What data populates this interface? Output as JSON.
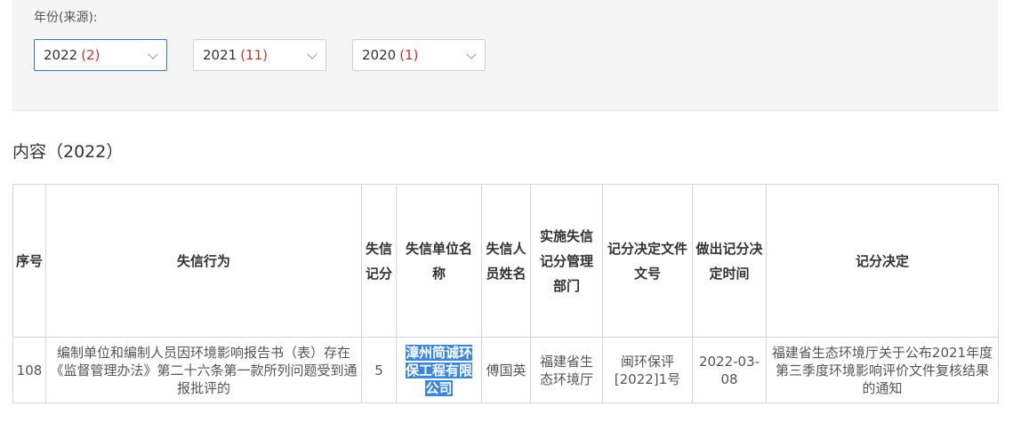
{
  "filter": {
    "label": "年份(来源):",
    "options": [
      {
        "year": "2022",
        "count": "(2)"
      },
      {
        "year": "2021",
        "count": "(11)"
      },
      {
        "year": "2020",
        "count": "(1)"
      }
    ]
  },
  "section_title": "内容（2022）",
  "table": {
    "headers": [
      "序号",
      "失信行为",
      "失信记分",
      "失信单位名称",
      "失信人员姓名",
      "实施失信记分管理部门",
      "记分决定文件文号",
      "做出记分决定时间",
      "记分决定"
    ],
    "rows": [
      {
        "index": "108",
        "behavior": "编制单位和编制人员因环境影响报告书（表）存在《监督管理办法》第二十六条第一款所列问题受到通报批评的",
        "score": "5",
        "unit": "漳州简诚环保工程有限公司",
        "person": "傅国英",
        "department": "福建省生态环境厅",
        "doc_no": "闽环保评[2022]1号",
        "date": "2022-03-08",
        "decision": "福建省生态环境厅关于公布2021年度第三季度环境影响评价文件复核结果的通知"
      }
    ]
  },
  "colors": {
    "accent_border": "#3a79b8",
    "count_red": "#c0392b",
    "highlight": "#3b88d8"
  }
}
